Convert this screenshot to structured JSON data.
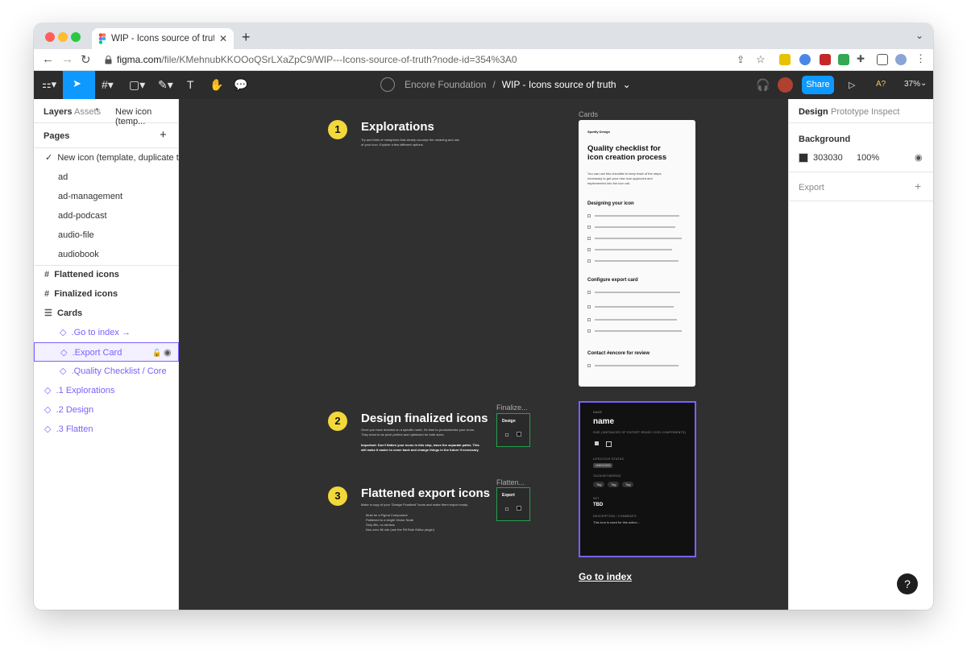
{
  "browser": {
    "tab_title": "WIP - Icons source of truth – F",
    "tab_close": "✕",
    "new_tab": "+",
    "tab_menu": "⌄",
    "url_host": "figma.com",
    "url_path": "/file/KMehnubKKOOoQSrLXaZpC9/WIP---Icons-source-of-truth?node-id=354%3A0",
    "back": "←",
    "forward": "→",
    "reload": "↻"
  },
  "toolbar": {
    "breadcrumb_team": "Encore Foundation",
    "breadcrumb_sep": "/",
    "file_name": "WIP - Icons source of truth",
    "share_label": "Share",
    "zoom": "37%",
    "font_missing": "A?"
  },
  "left_panel": {
    "tabs": [
      "Layers",
      "Assets",
      "New icon (temp..."
    ],
    "pages_heading": "Pages",
    "pages": [
      {
        "label": "New icon (template, duplicate t...",
        "current": true
      },
      {
        "label": "ad"
      },
      {
        "label": "ad-management"
      },
      {
        "label": "add-podcast"
      },
      {
        "label": "audio-file"
      },
      {
        "label": "audiobook"
      }
    ],
    "layers": [
      {
        "label": "Flattened icons",
        "type": "frame"
      },
      {
        "label": "Finalized icons",
        "type": "frame"
      },
      {
        "label": "Cards",
        "type": "section"
      },
      {
        "label": ".Go to index →",
        "type": "instance"
      },
      {
        "label": ".Export Card",
        "type": "instance",
        "selected": true
      },
      {
        "label": ".Quality Checklist / Core",
        "type": "instance"
      },
      {
        "label": ".1 Explorations",
        "type": "instance"
      },
      {
        "label": ".2 Design",
        "type": "instance"
      },
      {
        "label": ".3 Flatten",
        "type": "instance"
      }
    ]
  },
  "canvas": {
    "sections": [
      {
        "num": "1",
        "title": "Explorations",
        "body": "Try and think of metaphors that clearly conveys the meaning and use of your icon. Explore a few different options."
      },
      {
        "num": "2",
        "title": "Design finalized icons",
        "body": "Once you have decided on a specific route, it's time to productionise your icons. They need to be pixel perfect and optimized for both sizes.",
        "note": "Important: Don't flatten your icons in this step, leave the separate paths. This will make it easier to come back and change things in the future if necessary."
      },
      {
        "num": "3",
        "title": "Flattened export icons",
        "body": "Make a copy of your \"Design Finalized\" icons and make them export ready.",
        "bullets": [
          "Must be a Figma Component",
          "Flattened to a single Vector Node",
          "Only fills, no strokes",
          "Non-zero fill rule (use the Fill Rule Editor plugin)"
        ]
      }
    ],
    "frame_labels": {
      "cards": "Cards",
      "finalized": "Finalize...",
      "flattened": "Flatten..."
    },
    "mini_titles": {
      "design": "Design",
      "export": "Export"
    },
    "checklist": {
      "brand": "Spotify Design",
      "title": "Quality checklist for icon creation process",
      "intro": "You can use this checklist to keep track of the steps necessary to get your new icon approved and implemented into the icon set.",
      "s1": "Designing your icon",
      "s2": "Configure export card",
      "s3": "Contact #encore for review"
    },
    "export_card": {
      "name_label": "NAME",
      "name_value": "name",
      "sizes_label": "SIZE (INSTANCES OF EXPORT READY ICON COMPONENTS)",
      "status_label": "LIFECYCLE STATUS",
      "status_value": "UNKNOWN",
      "tags_label": "TAGS/KEYWORDS",
      "tag": "Tag",
      "set_label": "SET",
      "set_value": "TBD",
      "desc_label": "DESCRIPTION / COMMENTS",
      "desc_value": "This icon is used for this action..."
    },
    "go_to_index": "Go to index"
  },
  "right_panel": {
    "tabs": [
      "Design",
      "Prototype",
      "Inspect"
    ],
    "background_label": "Background",
    "bg_hex": "303030",
    "bg_opacity": "100%",
    "export_label": "Export",
    "bg_color": "#303030"
  },
  "help": "?"
}
